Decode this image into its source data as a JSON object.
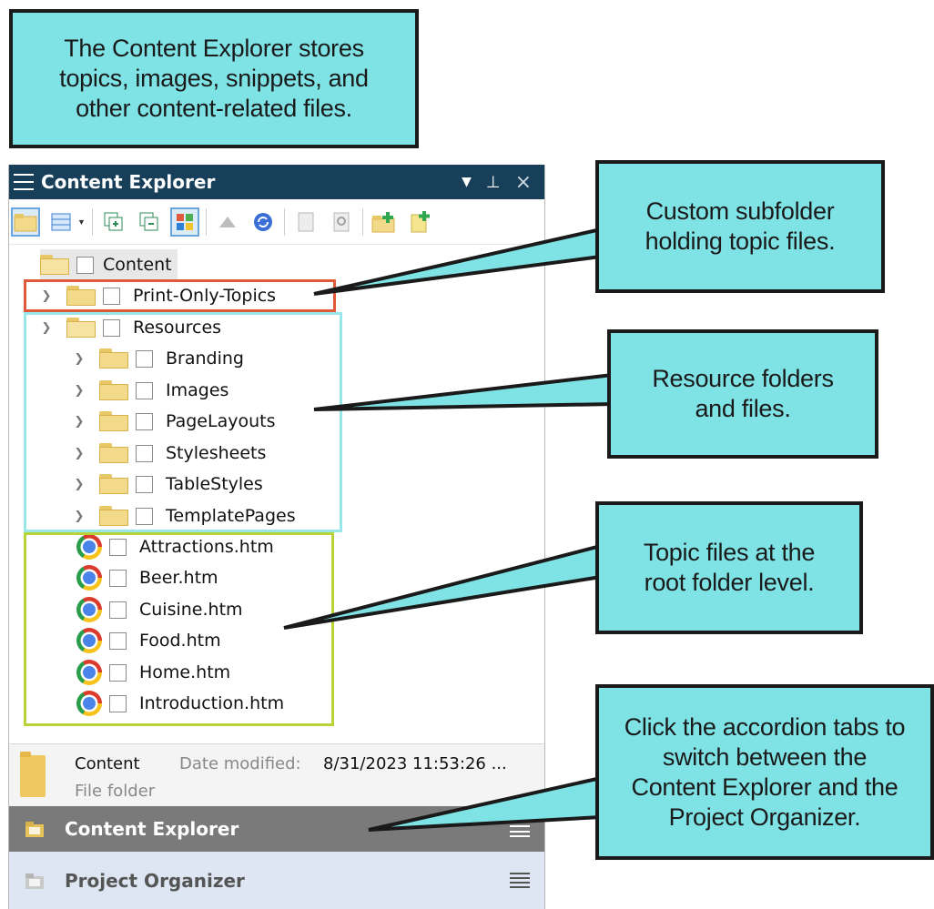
{
  "callouts": {
    "intro": "The Content Explorer stores\ntopics, images, snippets, and\nother content-related files.",
    "custom": "Custom subfolder\nholding topic files.",
    "resources": "Resource folders\nand files.",
    "topics": "Topic files at the\nroot folder level.",
    "accordion": "Click the accordion tabs to\nswitch between the\nContent Explorer and the\nProject Organizer."
  },
  "panel": {
    "title": "Content Explorer",
    "controls": {
      "dropdown": "▼",
      "pin": "⊥",
      "close": "×"
    }
  },
  "tree": {
    "root": "Content",
    "print_only": "Print-Only-Topics",
    "resources": "Resources",
    "resource_folders": [
      "Branding",
      "Images",
      "PageLayouts",
      "Stylesheets",
      "TableStyles",
      "TemplatePages"
    ],
    "files": [
      "Attractions.htm",
      "Beer.htm",
      "Cuisine.htm",
      "Food.htm",
      "Home.htm",
      "Introduction.htm"
    ]
  },
  "properties": {
    "name": "Content",
    "date_label": "Date modified:",
    "date_value": "8/31/2023 11:53:26 ...",
    "type": "File folder"
  },
  "accordion": {
    "tab1": "Content Explorer",
    "tab2": "Project Organizer"
  },
  "colors": {
    "callout_fill": "#7fe3e6",
    "titlebar": "#173f59",
    "highlight_red": "#e05a3a",
    "highlight_cyan": "#99e6e8",
    "highlight_green": "#b7d337"
  }
}
